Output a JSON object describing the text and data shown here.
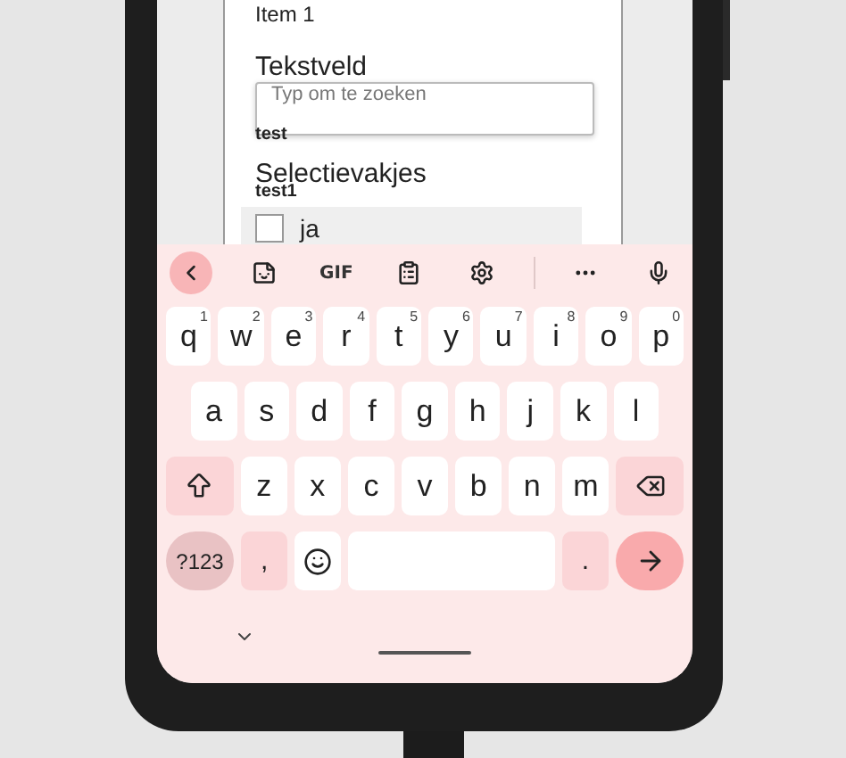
{
  "form": {
    "item_title": "Item 1",
    "text_field": {
      "label": "Tekstveld",
      "placeholder": "Typ om te zoeken"
    },
    "options": [
      {
        "label": "test"
      }
    ],
    "checkbox_group": {
      "label": "Selectievakjes"
    },
    "more_options": [
      {
        "label": "test1"
      }
    ],
    "checkboxes": [
      {
        "label": "ja",
        "checked": false
      }
    ]
  },
  "keyboard": {
    "toolbar": [
      {
        "kind": "back"
      },
      {
        "kind": "sticker"
      },
      {
        "kind": "text",
        "label": "GIF"
      },
      {
        "kind": "clipboard"
      },
      {
        "kind": "settings"
      },
      {
        "kind": "divider"
      },
      {
        "kind": "more"
      },
      {
        "kind": "mic"
      }
    ],
    "rows": [
      {
        "keys": [
          {
            "kind": "letter",
            "label": "q",
            "hint": "1"
          },
          {
            "kind": "letter",
            "label": "w",
            "hint": "2"
          },
          {
            "kind": "letter",
            "label": "e",
            "hint": "3"
          },
          {
            "kind": "letter",
            "label": "r",
            "hint": "4"
          },
          {
            "kind": "letter",
            "label": "t",
            "hint": "5"
          },
          {
            "kind": "letter",
            "label": "y",
            "hint": "6"
          },
          {
            "kind": "letter",
            "label": "u",
            "hint": "7"
          },
          {
            "kind": "letter",
            "label": "i",
            "hint": "8"
          },
          {
            "kind": "letter",
            "label": "o",
            "hint": "9"
          },
          {
            "kind": "letter",
            "label": "p",
            "hint": "0"
          }
        ]
      },
      {
        "keys": [
          {
            "kind": "letter",
            "label": "a"
          },
          {
            "kind": "letter",
            "label": "s"
          },
          {
            "kind": "letter",
            "label": "d"
          },
          {
            "kind": "letter",
            "label": "f"
          },
          {
            "kind": "letter",
            "label": "g"
          },
          {
            "kind": "letter",
            "label": "h"
          },
          {
            "kind": "letter",
            "label": "j"
          },
          {
            "kind": "letter",
            "label": "k"
          },
          {
            "kind": "letter",
            "label": "l"
          }
        ]
      },
      {
        "keys": [
          {
            "kind": "shift"
          },
          {
            "kind": "letter",
            "label": "z"
          },
          {
            "kind": "letter",
            "label": "x"
          },
          {
            "kind": "letter",
            "label": "c"
          },
          {
            "kind": "letter",
            "label": "v"
          },
          {
            "kind": "letter",
            "label": "b"
          },
          {
            "kind": "letter",
            "label": "n"
          },
          {
            "kind": "letter",
            "label": "m"
          },
          {
            "kind": "backspace"
          }
        ]
      },
      {
        "keys": [
          {
            "kind": "symbols",
            "label": "?123"
          },
          {
            "kind": "punct",
            "label": ","
          },
          {
            "kind": "emoji"
          },
          {
            "kind": "space"
          },
          {
            "kind": "punct",
            "label": "."
          },
          {
            "kind": "enter"
          }
        ]
      }
    ]
  }
}
